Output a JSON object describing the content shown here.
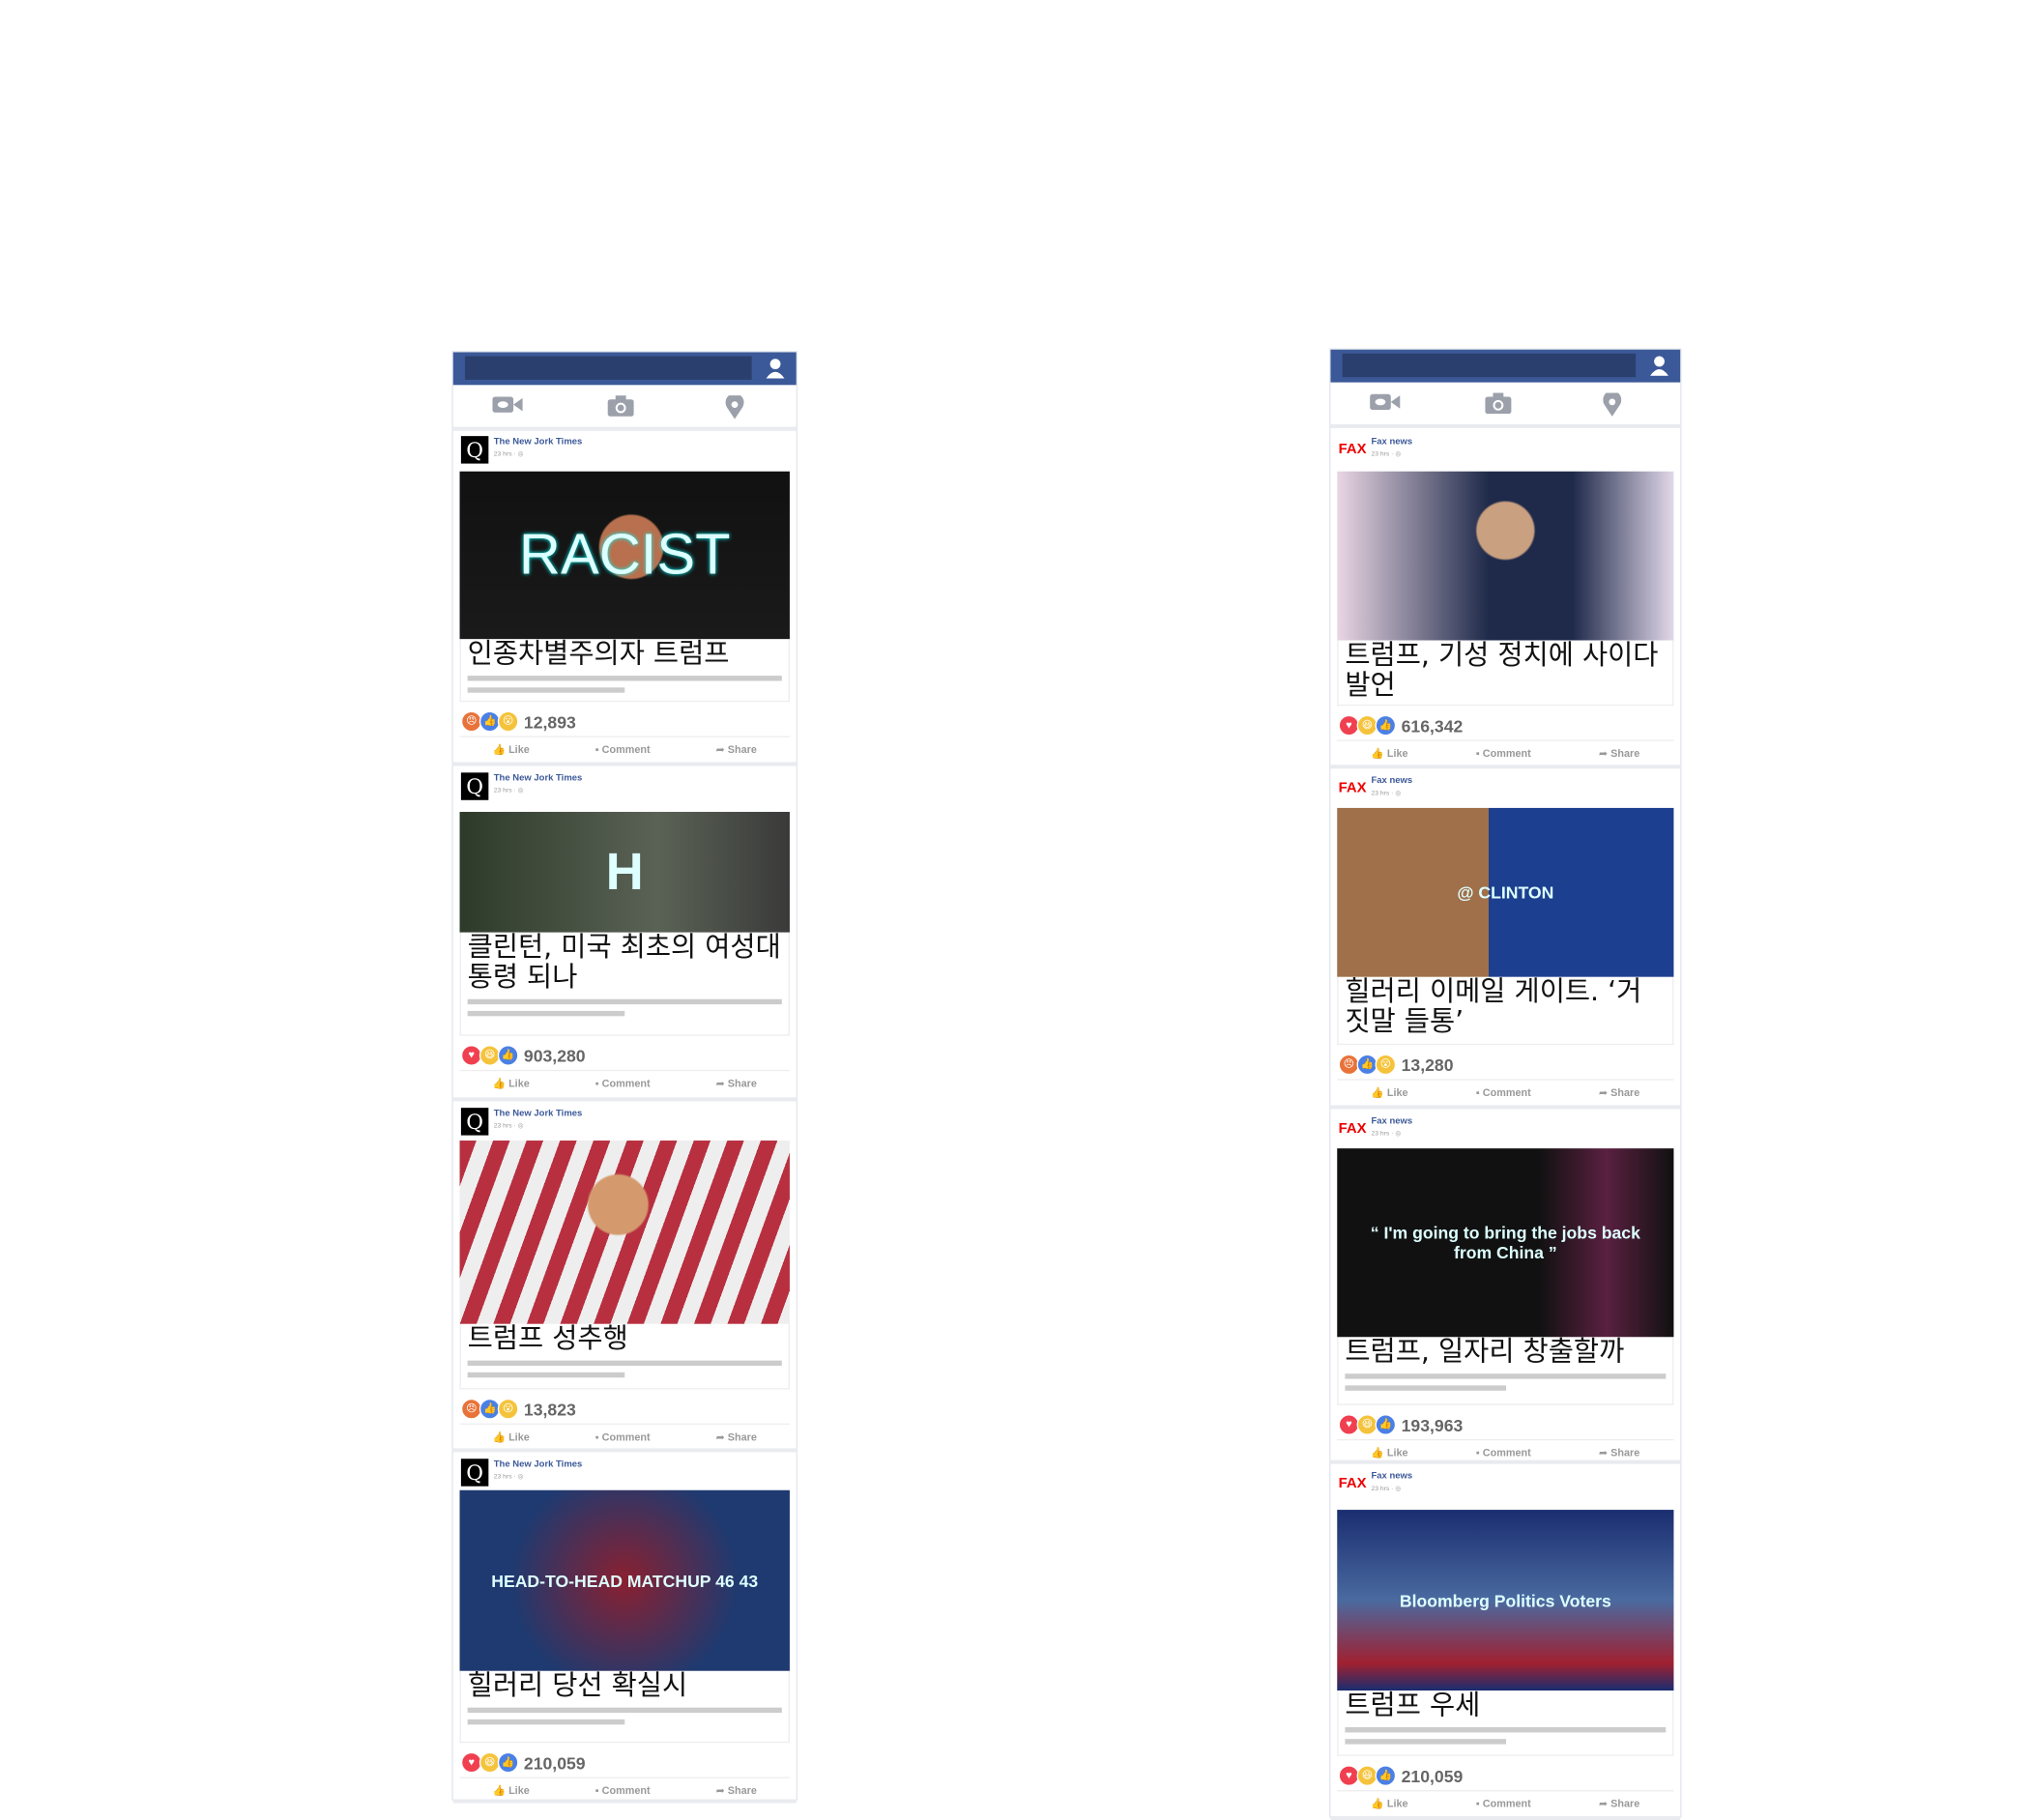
{
  "colors": {
    "brand": "#3b5998",
    "searchbar": "#2b3f6e",
    "icon": "#9ba0aa",
    "fax": "#e00000"
  },
  "actions": {
    "like": "Like",
    "comment": "Comment",
    "share": "Share"
  },
  "columns": [
    {
      "name": "left-feed",
      "posts": [
        {
          "source": "The New Jork Times",
          "logo": "Q",
          "time": "23 hrs · ◎",
          "image_text": "RACIST",
          "headline": "인종차별주의자 트럼프",
          "reactions": [
            "angry",
            "like",
            "wow"
          ],
          "count": "12,893"
        },
        {
          "source": "The New Jork Times",
          "logo": "Q",
          "time": "23 hrs · ◎",
          "image_text": "H",
          "headline": "클린턴, 미국 최초의 여성대통령 되나",
          "reactions": [
            "love",
            "haha",
            "like"
          ],
          "count": "903,280"
        },
        {
          "source": "The New Jork Times",
          "logo": "Q",
          "time": "23 hrs · ◎",
          "image_text": "",
          "headline": "트럼프 성추행",
          "reactions": [
            "angry",
            "like",
            "wow"
          ],
          "count": "13,823"
        },
        {
          "source": "The New Jork Times",
          "logo": "Q",
          "time": "23 hrs · ◎",
          "image_text": "HEAD-TO-HEAD MATCHUP  46  43",
          "headline": "힐러리 당선 확실시",
          "reactions": [
            "love",
            "haha",
            "like"
          ],
          "count": "210,059"
        }
      ]
    },
    {
      "name": "right-feed",
      "posts": [
        {
          "source": "Fax news",
          "logo": "FAX",
          "time": "23 hrs · ◎",
          "image_text": "",
          "headline": "트럼프, 기성 정치에 사이다 발언",
          "reactions": [
            "love",
            "haha",
            "like"
          ],
          "count": "616,342"
        },
        {
          "source": "Fax news",
          "logo": "FAX",
          "time": "23 hrs · ◎",
          "image_text": "@ CLINTON",
          "headline": "힐러리 이메일 게이트. ‘거짓말 들통’",
          "reactions": [
            "angry",
            "like",
            "wow"
          ],
          "count": "13,280"
        },
        {
          "source": "Fax news",
          "logo": "FAX",
          "time": "23 hrs · ◎",
          "image_text": "“ I'm going to bring the jobs back from China ”",
          "headline": "트럼프, 일자리 창출할까",
          "reactions": [
            "love",
            "haha",
            "like"
          ],
          "count": "193,963"
        },
        {
          "source": "Fax news",
          "logo": "FAX",
          "time": "23 hrs · ◎",
          "image_text": "Bloomberg Politics Voters",
          "headline": "트럼프 우세",
          "reactions": [
            "love",
            "haha",
            "like"
          ],
          "count": "210,059"
        }
      ]
    }
  ]
}
